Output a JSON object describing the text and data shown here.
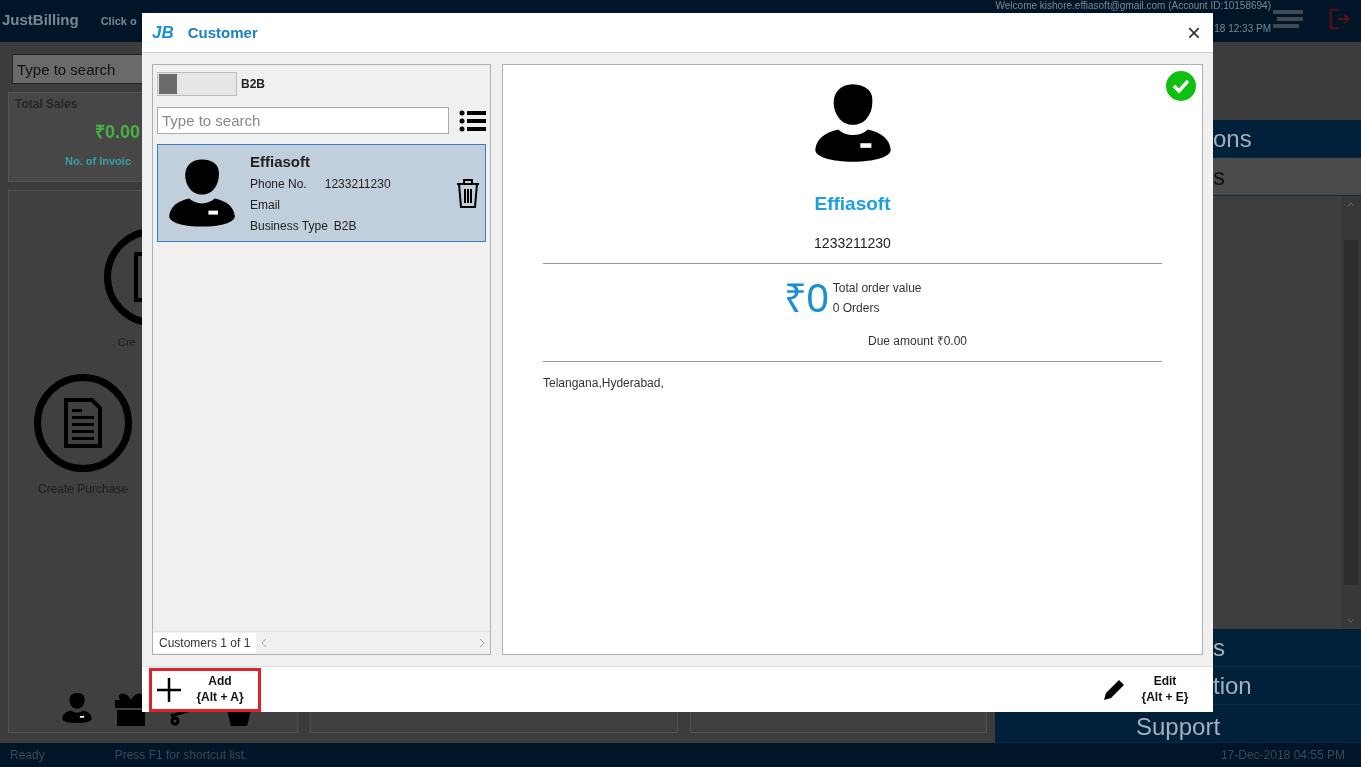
{
  "app": {
    "logo": "JustBilling",
    "hint": "Click o",
    "welcome": "Welcome kishore.effiasoft@gmail.com (Account ID:10158694)",
    "datetime": "18 12:33 PM",
    "search": {
      "placeholder": "Type to search"
    },
    "sales_card": {
      "title": "Total Sales",
      "amount": "₹0.00",
      "subtitle": "No. of Invoic"
    },
    "actions": [
      {
        "label": "Cre"
      },
      {
        "label": "Create Purchase"
      }
    ],
    "menu": [
      {
        "label": "ons",
        "selected": false
      },
      {
        "label": "s",
        "selected": true
      },
      {
        "label": "s",
        "selected": false
      },
      {
        "label": "tion",
        "selected": false
      },
      {
        "label": "Support",
        "selected": false
      }
    ]
  },
  "dialog": {
    "logo": "JB",
    "title": "Customer",
    "close": "×",
    "filter": {
      "on": false,
      "label": "B2B"
    },
    "search": {
      "placeholder": "Type to search"
    },
    "customers": [
      {
        "name": "Effiasoft",
        "phone_label": "Phone No.",
        "phone": "1233211230",
        "email_label": "Email",
        "business_type_label": "Business Type",
        "business_type": "B2B",
        "selected": true
      }
    ],
    "count": "Customers 1 of 1",
    "detail": {
      "verified": true,
      "name": "Effiasoft",
      "phone": "1233211230",
      "total": "₹0",
      "total_label": "Total order value",
      "orders": "0 Orders",
      "due": "Due amount ₹0.00",
      "address": "Telangana,Hyderabad,"
    },
    "buttons": [
      {
        "kind": "add",
        "label": "Add",
        "shortcut": "{Alt + A}",
        "highlighted": true
      },
      {
        "kind": "edit",
        "label": "Edit",
        "shortcut": "{Alt + E}",
        "highlighted": false
      }
    ]
  },
  "status_bar": {
    "status": "Ready",
    "hint": "Press F1 for shortcut list.",
    "datetime": "17-Dec-2018 04:55 PM"
  }
}
